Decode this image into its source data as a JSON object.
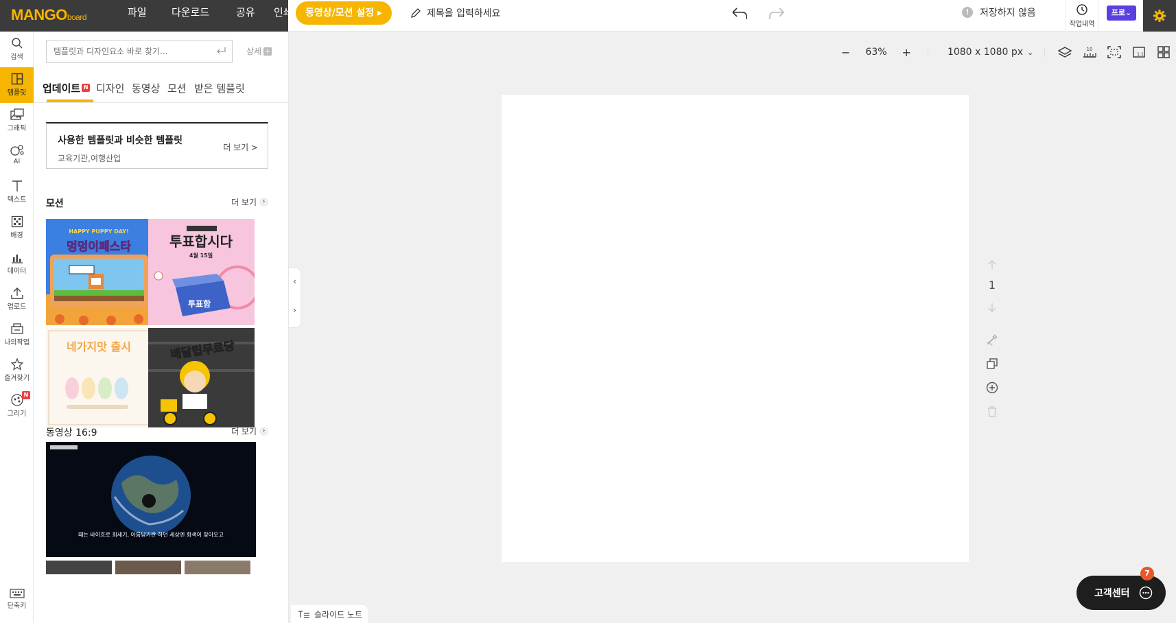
{
  "app": {
    "logo_main": "MANGO",
    "logo_sub": "board",
    "menu": [
      "파일",
      "다운로드",
      "공유",
      "인쇄"
    ],
    "motion_button": "동영상/모션 설정 ▸",
    "title_placeholder": "제목을 입력하세요",
    "unsaved_status": "저장하지 않음",
    "history_label": "작업내역",
    "pro_label": "프로",
    "accent": "#f6b500",
    "pro_color": "#5b3fe0"
  },
  "leftbar": {
    "items": [
      {
        "label": "검색",
        "icon": "search-icon"
      },
      {
        "label": "템플릿",
        "icon": "template-icon"
      },
      {
        "label": "그래픽",
        "icon": "graphic-icon"
      },
      {
        "label": "AI",
        "icon": "ai-icon"
      },
      {
        "label": "텍스트",
        "icon": "text-icon"
      },
      {
        "label": "배경",
        "icon": "background-icon"
      },
      {
        "label": "데이터",
        "icon": "chart-icon"
      },
      {
        "label": "업로드",
        "icon": "upload-icon"
      },
      {
        "label": "나의작업",
        "icon": "my-work-icon"
      },
      {
        "label": "즐겨찾기",
        "icon": "star-icon"
      },
      {
        "label": "그리기",
        "icon": "draw-icon"
      }
    ],
    "new_badge": "N",
    "shortcut_label": "단축키"
  },
  "panel": {
    "search_placeholder": "템플릿과 디자인요소 바로 찾기...",
    "detail_label": "상세",
    "tabs": [
      "업데이트",
      "디자인",
      "동영상",
      "모션",
      "받은 템플릿"
    ],
    "tab_badge": "N",
    "similar": {
      "title": "사용한 템플릿과 비슷한 템플릿",
      "subtitle": "교육기관,여행산업",
      "more": "더 보기 >"
    },
    "motion_section": {
      "title": "모션",
      "more": "더 보기"
    },
    "video_section": {
      "title": "동영상 16:9",
      "more": "더 보기"
    },
    "thumbs": {
      "t1_title": "멍멍이페스타",
      "t1_top": "HAPPY PUPPY DAY!",
      "t2_title": "투표합시다",
      "t2_date": "4월 15일",
      "t2_box": "투표함",
      "t3_title": "네가지맛 출시",
      "t4_title": "배달팁무료당",
      "video_caption": "때는 바이흐로 최세기, 아름답기란 하던 세상엔 회색이 찾아오고"
    }
  },
  "canvas": {
    "zoom": "63%",
    "size": "1080 x 1080 px",
    "page_number": "1"
  },
  "footer": {
    "slide_note": "슬라이드 노트",
    "support": "고객센터",
    "support_count": "7"
  }
}
